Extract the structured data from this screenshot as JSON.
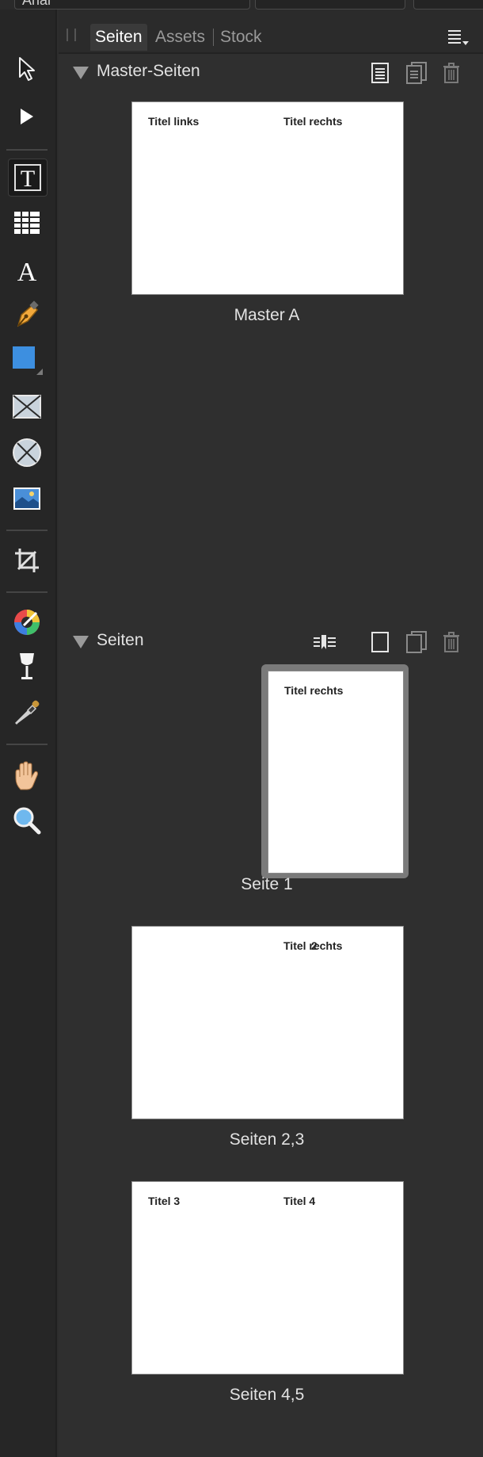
{
  "top_bar": {
    "font_field_value": "Arial"
  },
  "toolbar": {
    "tools": [
      {
        "name": "move-tool-icon"
      },
      {
        "name": "node-tool-icon"
      },
      {
        "name": "frame-text-tool-icon",
        "active": true
      },
      {
        "name": "table-tool-icon"
      },
      {
        "name": "artistic-text-tool-icon"
      },
      {
        "name": "pen-tool-icon"
      },
      {
        "name": "rectangle-tool-icon"
      },
      {
        "name": "picture-frame-rectangle-icon"
      },
      {
        "name": "picture-frame-ellipse-icon"
      },
      {
        "name": "place-image-icon"
      },
      {
        "name": "crop-tool-icon"
      },
      {
        "name": "fill-tool-icon"
      },
      {
        "name": "transparency-tool-icon"
      },
      {
        "name": "color-picker-icon"
      },
      {
        "name": "view-tool-icon"
      },
      {
        "name": "zoom-tool-icon"
      }
    ]
  },
  "panel": {
    "tabs": [
      {
        "label": "Seiten",
        "active": true
      },
      {
        "label": "Assets"
      },
      {
        "label": "Stock"
      }
    ],
    "master_section": {
      "title": "Master-Seiten",
      "items": [
        {
          "caption": "Master A",
          "left_text": "Titel links",
          "right_text": "Titel rechts"
        }
      ]
    },
    "pages_section": {
      "title": "Seiten",
      "items": [
        {
          "caption": "Seite 1",
          "right_text": "Titel rechts",
          "selected": true
        },
        {
          "caption": "Seiten 2,3",
          "right_text": "Titel rechts",
          "overlay_text": "2"
        },
        {
          "caption": "Seiten 4,5",
          "left_text": "Titel 3",
          "right_text": "Titel 4"
        }
      ]
    }
  },
  "colors": {
    "panel_bg": "#2f2f2f",
    "toolbar_bg": "#262626",
    "accent_blue": "#3d8fe0"
  }
}
